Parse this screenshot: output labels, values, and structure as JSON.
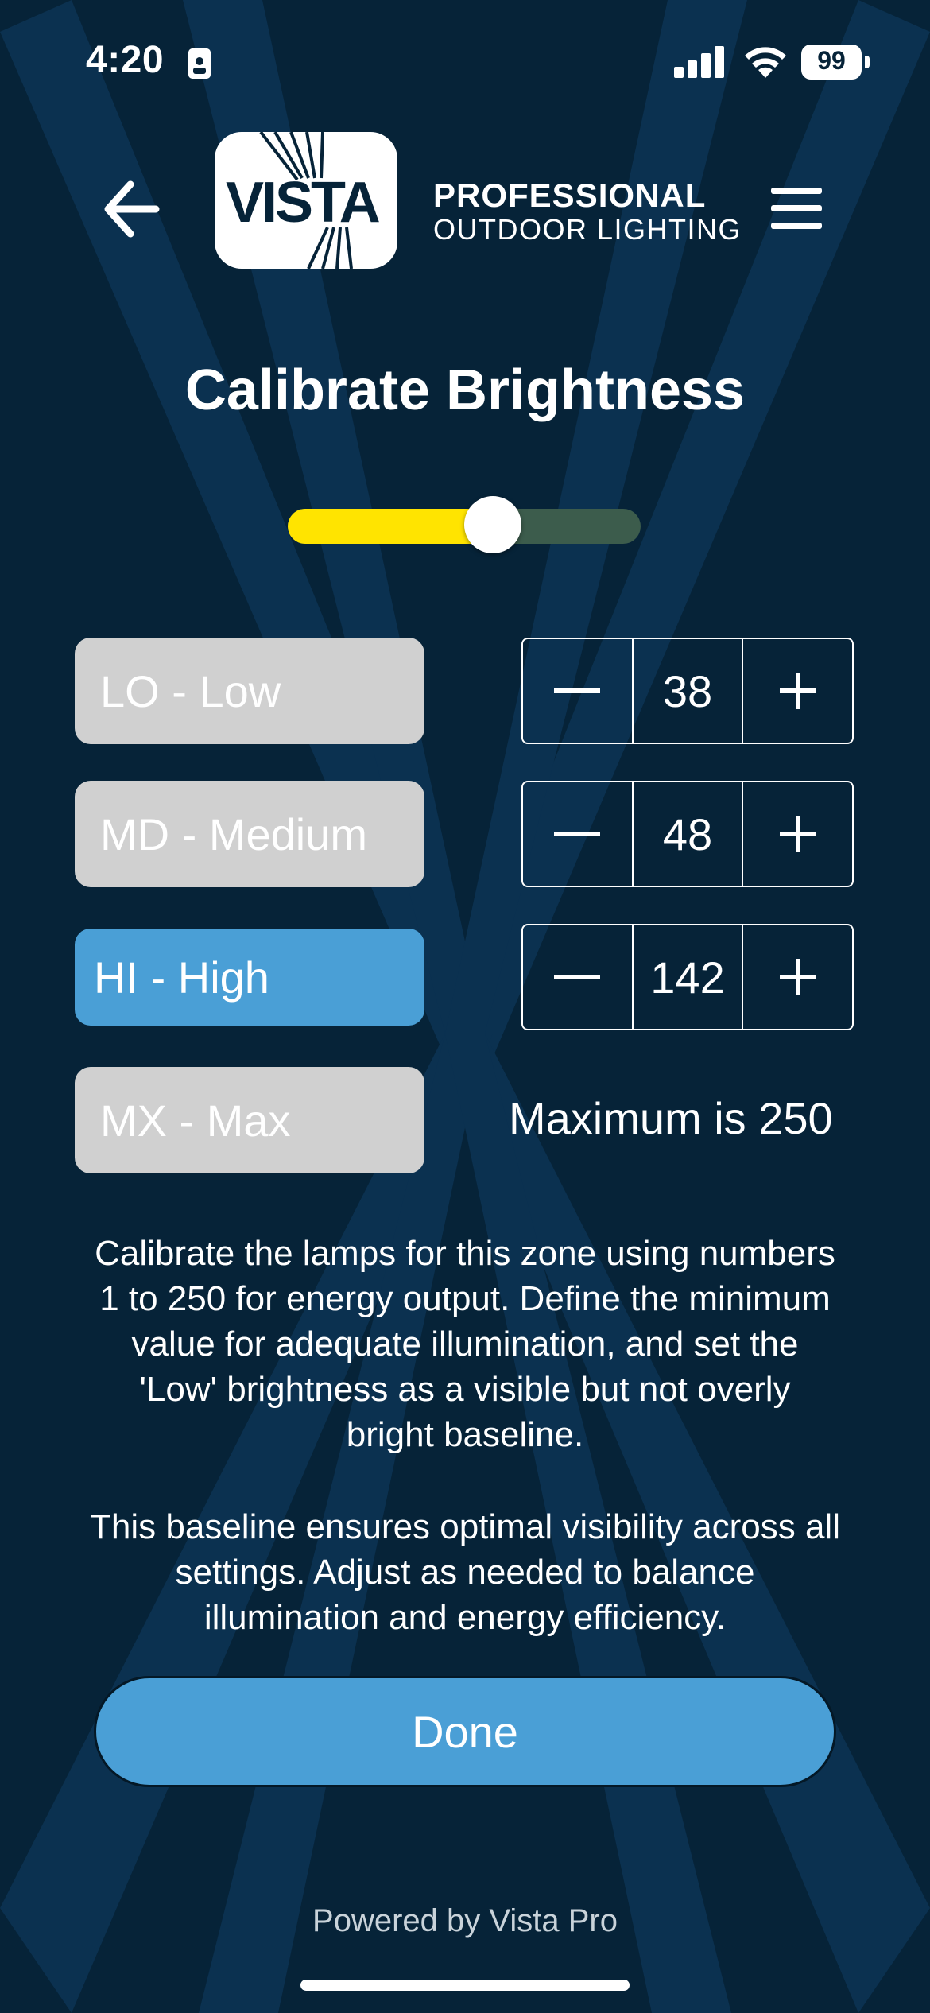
{
  "status_bar": {
    "time": "4:20",
    "battery": "99",
    "icons": [
      "id-card-icon",
      "cellular-signal-icon",
      "wifi-icon",
      "battery-icon"
    ]
  },
  "header": {
    "logo_text": "VISTA",
    "brand_line1": "PROFESSIONAL",
    "brand_line2": "OUTDOOR LIGHTING",
    "icons": [
      "back-arrow-icon",
      "hamburger-menu-icon"
    ]
  },
  "title": "Calibrate Brightness",
  "slider": {
    "value_fraction": 0.58,
    "fill_color": "#ffe400",
    "track_color": "#3c5c4c"
  },
  "levels": [
    {
      "label": "LO - Low",
      "value": "38",
      "active": false
    },
    {
      "label": "MD - Medium",
      "value": "48",
      "active": false
    },
    {
      "label": "HI - High",
      "value": "142",
      "active": true
    },
    {
      "label": "MX - Max",
      "active": false
    }
  ],
  "max_text": "Maximum is 250",
  "description": {
    "paragraph1_lines": [
      "Calibrate the lamps for this zone using numbers",
      "1 to 250 for energy output. Define the minimum",
      "value for adequate illumination, and set the",
      "'Low' brightness as a visible but not overly",
      "bright baseline."
    ],
    "paragraph2_lines": [
      "This baseline ensures optimal visibility across all",
      "settings. Adjust as needed to balance",
      "illumination and energy efficiency."
    ]
  },
  "done_label": "Done",
  "footer": "Powered by Vista Pro",
  "colors": {
    "background": "#062338",
    "accent": "#4a9fd6",
    "inactive_button": "#d0d0d0"
  }
}
